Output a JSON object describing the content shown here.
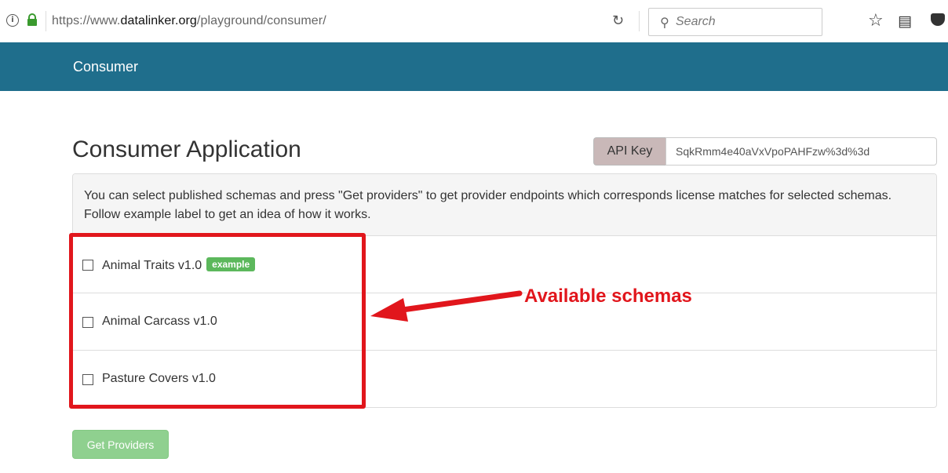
{
  "browser": {
    "url_prefix": "https://www.",
    "url_host": "datalinker.org",
    "url_path": "/playground/consumer/",
    "search_placeholder": "Search"
  },
  "navbar": {
    "brand": "Consumer"
  },
  "header": {
    "title": "Consumer Application",
    "api_key_label": "API Key",
    "api_key_value": "SqkRmm4e40aVxVpoPAHFzw%3d%3d"
  },
  "panel": {
    "description": "You can select published schemas and press \"Get providers\" to get provider endpoints which corresponds license matches for selected schemas. Follow example label to get an idea of how it works.",
    "schemas": [
      {
        "label": "Animal Traits v1.0",
        "badge": "example",
        "checked": false
      },
      {
        "label": "Animal Carcass v1.0",
        "checked": false
      },
      {
        "label": "Pasture Covers v1.0",
        "checked": false
      }
    ]
  },
  "annotation": {
    "text": "Available schemas",
    "color": "#e1161c"
  },
  "actions": {
    "get_providers_label": "Get Providers"
  },
  "colors": {
    "navbar": "#1f6e8c",
    "badge": "#5cb85c",
    "button": "#8fd08f"
  }
}
